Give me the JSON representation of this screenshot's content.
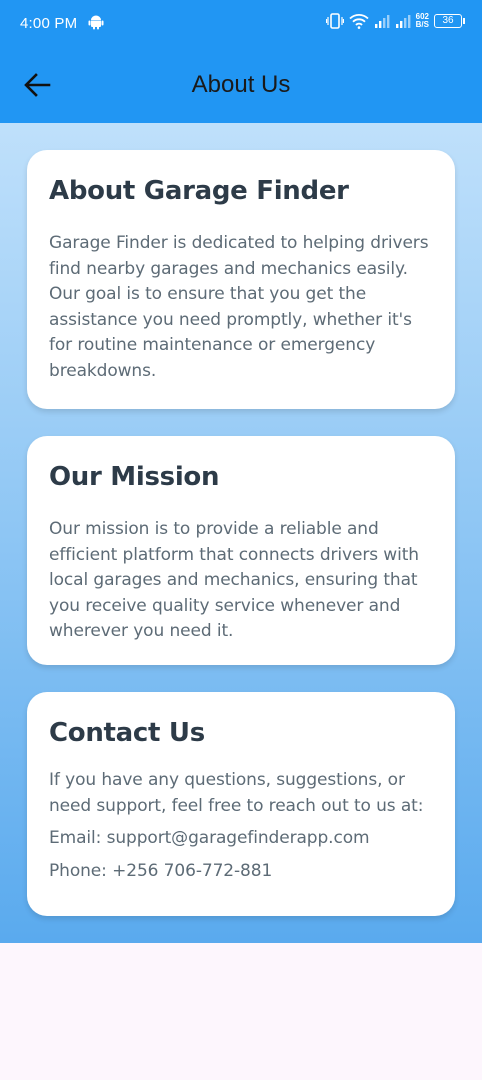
{
  "status_bar": {
    "time": "4:00 PM",
    "speed_value": "602",
    "speed_unit": "B/S",
    "battery": "36"
  },
  "header": {
    "title": "About Us",
    "back_icon": "arrow-back-icon"
  },
  "colors": {
    "app_bar": "#2196f3",
    "gradient_top": "#bfe0fb",
    "gradient_bottom": "#5aaaee",
    "heading": "#2d3b48",
    "body_text": "#5d6b76"
  },
  "sections": {
    "about": {
      "title": "About Garage Finder",
      "body": "Garage Finder is dedicated to helping drivers find nearby garages and mechanics easily. Our goal is to ensure that you get the assistance you need promptly, whether it's for routine maintenance or emergency breakdowns."
    },
    "mission": {
      "title": "Our Mission",
      "body": "Our mission is to provide a reliable and efficient platform that connects drivers with local garages and mechanics, ensuring that you receive quality service whenever and wherever you need it."
    },
    "contact": {
      "title": "Contact Us",
      "intro": "If you have any questions, suggestions, or need support, feel free to reach out to us at:",
      "email": "Email: support@garagefinderapp.com",
      "phone": "Phone: +256 706-772-881"
    }
  }
}
